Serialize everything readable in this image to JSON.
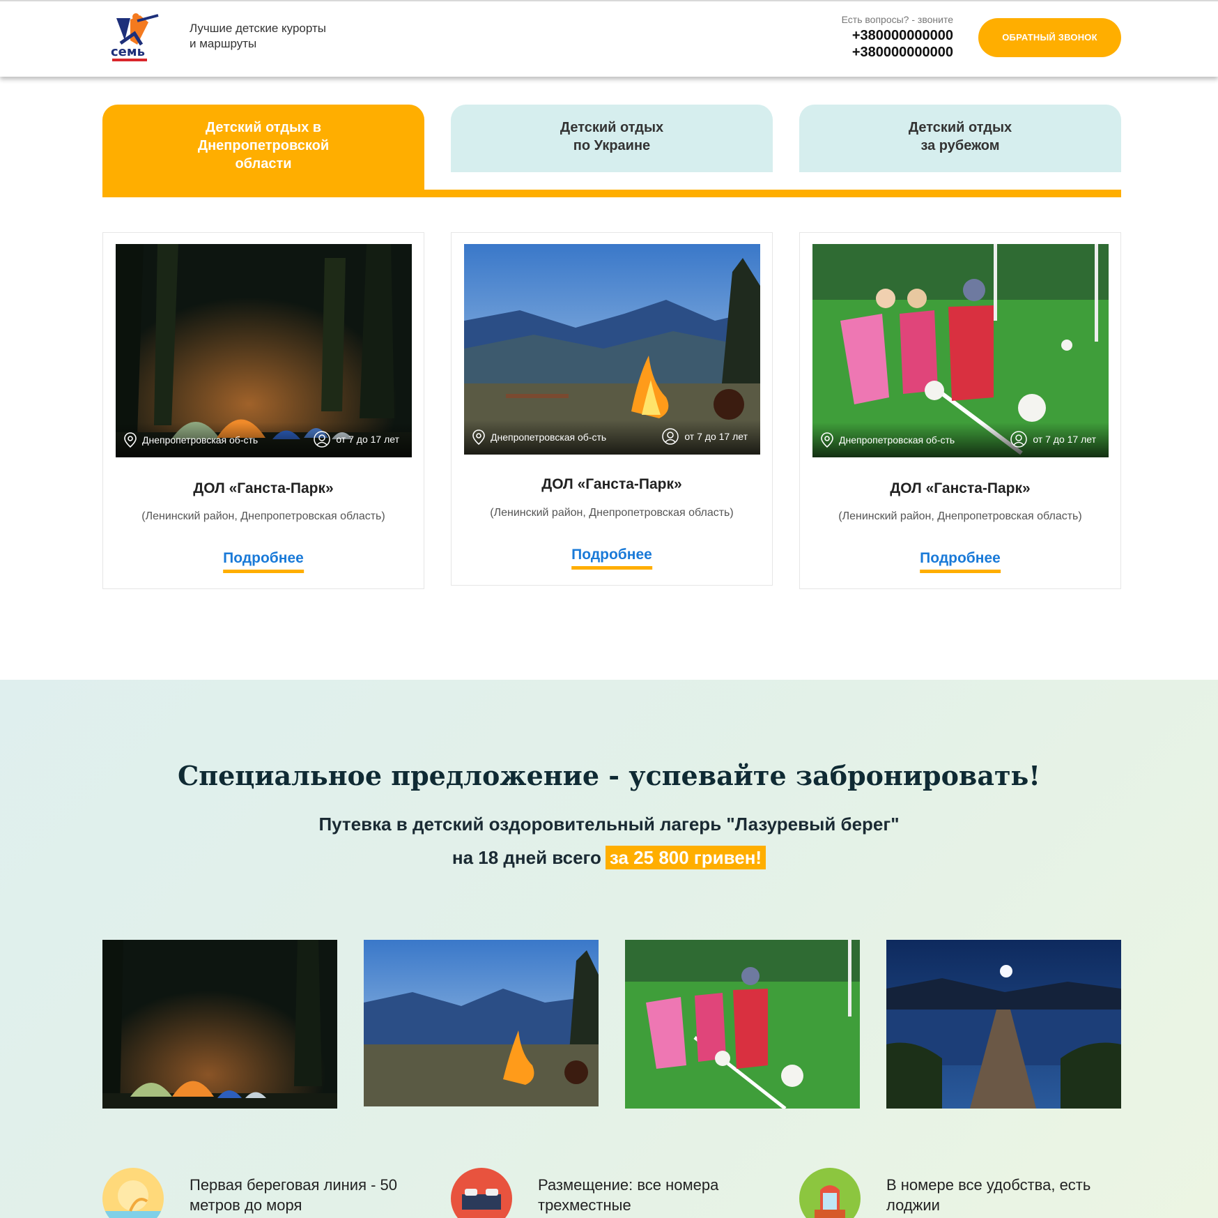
{
  "header": {
    "tagline": "Лучшие детские курорты и маршруты",
    "contact_label": "Есть вопросы? - звоните",
    "phone1": "+380000000000",
    "phone2": "+380000000000",
    "callback_label": "ОБРАТНЫЙ ЗВОНОК",
    "logo_text": "семь",
    "brand_color": "#ffae00"
  },
  "tabs": [
    {
      "label": "Детский отдых в Днепропетровской области",
      "active": true
    },
    {
      "label": "Детский отдых по Украине",
      "active": false
    },
    {
      "label": "Детский отдых за рубежом",
      "active": false
    }
  ],
  "cards": [
    {
      "location": "Днепропетровская об-сть",
      "age": "от 7 до 17 лет",
      "title": "ДОЛ «Ганста-Парк»",
      "subtitle": "(Ленинский район, Днепропетровская область)",
      "more": "Подробнее",
      "image": "tents-night"
    },
    {
      "location": "Днепропетровская об-сть",
      "age": "от 7 до 17 лет",
      "title": "ДОЛ «Ганста-Парк»",
      "subtitle": "(Ленинский район, Днепропетровская область)",
      "more": "Подробнее",
      "image": "campfire-mountains"
    },
    {
      "location": "Днепропетровская об-сть",
      "age": "от 7 до 17 лет",
      "title": "ДОЛ «Ганста-Парк»",
      "subtitle": "(Ленинский район, Днепропетровская область)",
      "more": "Подробнее",
      "image": "kids-football"
    }
  ],
  "special": {
    "title": "Специальное предложение - успевайте забронировать!",
    "line1": "Путевка в детский оздоровительный лагерь \"Лазуревый берег\"",
    "line2_prefix": "на 18 дней всего",
    "price": "за 25 800 гривен!",
    "gallery": [
      "tents-night",
      "campfire-mountains",
      "kids-football",
      "lake-pier-night"
    ],
    "features": [
      {
        "text": "Первая береговая линия - 50 метров до моря",
        "icon": "beach-icon"
      },
      {
        "text": "Размещение: все номера трехместные",
        "icon": "bed-icon"
      },
      {
        "text": "В номере все удобства, есть лоджии",
        "icon": "balcony-icon"
      }
    ]
  }
}
